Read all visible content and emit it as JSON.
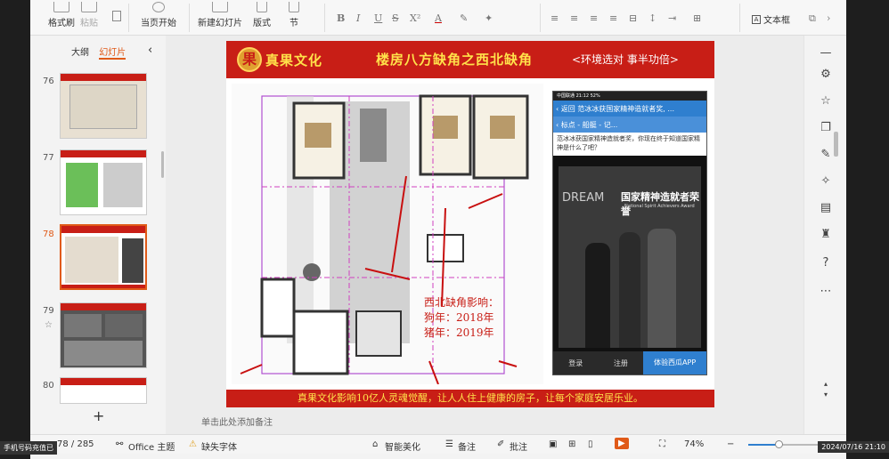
{
  "ribbon": {
    "format_painter": "格式刷",
    "paste": "粘贴",
    "play_from_current": "当页开始",
    "new_slide": "新建幻灯片",
    "layout": "版式",
    "section": "节",
    "text_box": "文本框"
  },
  "panel": {
    "tab_outline": "大纲",
    "tab_slides": "幻灯片",
    "slide_numbers": [
      "76",
      "77",
      "78",
      "79",
      "80"
    ],
    "add_slide": "+"
  },
  "slide": {
    "brand": "真果文化",
    "title": "楼房八方缺角之西北缺角",
    "subtitle": "<环境选对 事半功倍>",
    "footer": "真果文化影响10亿人灵魂觉醒，让人人住上健康的房子，让每个家庭安居乐业。",
    "annotation_line1": "西北缺角影响：",
    "annotation_line2": "狗年：2018年",
    "annotation_line3": "猪年：2019年"
  },
  "phone": {
    "status": "中国联通  21:12  52%",
    "back_label": "返回",
    "nav_title": "范冰冰获国家精神造就者奖, ...",
    "sub_nav": "标点 - 船艇 - 记...",
    "article_text": "范冰冰获国家精神造就者奖，你现在终于知道国家精神是什么了吧？",
    "award_title": "国家精神造就者荣誉",
    "award_sub": "National Spirit Achievers Award",
    "dream": "DREAM",
    "login": "登录",
    "register": "注册",
    "open_app": "体验西瓜APP"
  },
  "notes_placeholder": "单击此处添加备注",
  "statusbar": {
    "page": "78 / 285",
    "theme": "Office 主题",
    "missing_font": "缺失字体",
    "smart_beautify": "智能美化",
    "notes": "备注",
    "comments": "批注",
    "zoom": "74%"
  },
  "taskbar": {
    "left": "手机号码充值已",
    "right": "2024/07/16 21:10"
  },
  "colors": {
    "slide_red": "#c81e16",
    "title_yellow": "#ffe24a",
    "accent_orange": "#e05a18",
    "phone_blue": "#2f7fcf"
  }
}
